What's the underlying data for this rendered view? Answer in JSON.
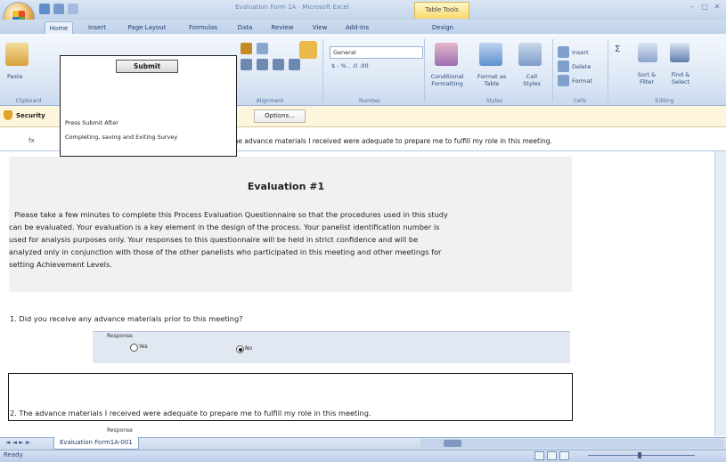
{
  "window": {
    "title": "Evaluation Form 1A - Microsoft Excel",
    "context_tab": "Table Tools",
    "controls": {
      "minimize": "–",
      "maximize": "□",
      "close": "✕"
    }
  },
  "ribbon_tabs": [
    "Home",
    "Insert",
    "Page Layout",
    "Formulas",
    "Data",
    "Review",
    "View",
    "Add-Ins",
    "Design"
  ],
  "ribbon": {
    "paste_label": "Paste",
    "clipboard_label": "Clipboard",
    "number_format": "General",
    "number_symbols": "$  -  %  ,  .0 .00",
    "alignment_label": "Alignment",
    "number_label": "Number",
    "styles": {
      "conditional": "Conditional Formatting",
      "format_table": "Format as Table",
      "cell_styles": "Cell Styles",
      "label": "Styles"
    },
    "cells": {
      "insert": "Insert",
      "delete": "Delete",
      "format": "Format",
      "label": "Cells"
    },
    "editing": {
      "sort": "Sort & Filter",
      "find": "Find & Select",
      "label": "Editing"
    }
  },
  "popup": {
    "submit": "Submit",
    "line1": "Press Submit After",
    "line2": "Completing, saving and Exiting Survey"
  },
  "message_bar": {
    "security_label": "Security",
    "options": "Options..."
  },
  "formula_bar": {
    "fx": "fx",
    "content": "The advance materials I received were adequate to prepare me to fulfill my role in this meeting."
  },
  "sheet": {
    "title": "Evaluation #1",
    "paragraph": [
      "Please take a few minutes to complete this Process Evaluation Questionnaire so that the procedures used in this study",
      "can be evaluated. Your evaluation is a key element in the design of the process. Your panelist identification number is",
      "used for analysis purposes only. Your responses to this questionnaire will be held in strict confidence and will be",
      "analyzed only in conjunction with those of the other panelists who participated in this meeting and other meetings for",
      "setting Achievement Levels."
    ],
    "q1": "1. Did you receive any advance materials prior to this meeting?",
    "response_label": "Response",
    "options": [
      "Yes",
      "No"
    ],
    "selected": "No",
    "q2": "2. The advance materials I received were adequate to prepare me to fulfill my role in this meeting.",
    "response_label2": "Response"
  },
  "sheet_tabs": {
    "nav": "◄ ◄ ► ►",
    "active": "Evaluation Form1A-001"
  },
  "status": {
    "text": "Ready"
  },
  "colors": {
    "ribbon": "#dbe6f4",
    "message_bar": "#fdf6dc",
    "response_bg": "#e2e8f2"
  }
}
